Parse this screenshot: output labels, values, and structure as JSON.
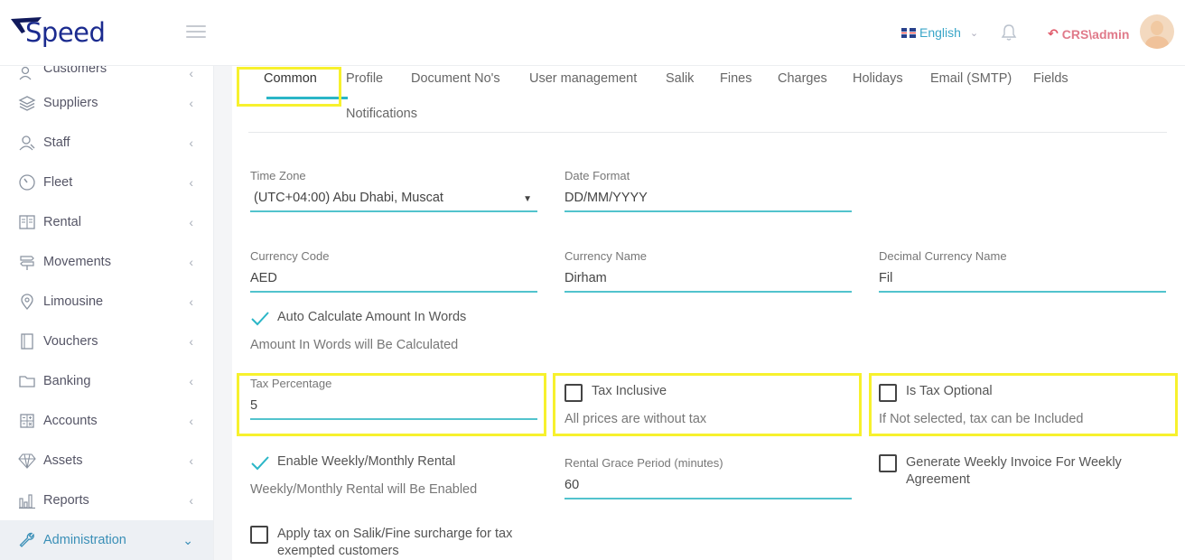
{
  "brand": {
    "name": "Speed"
  },
  "header": {
    "language": "English",
    "user": "CRS\\admin"
  },
  "sidebar": {
    "items": [
      {
        "label": "Customers",
        "icon": "users-icon"
      },
      {
        "label": "Suppliers",
        "icon": "layers-icon"
      },
      {
        "label": "Staff",
        "icon": "staff-icon"
      },
      {
        "label": "Fleet",
        "icon": "gauge-icon"
      },
      {
        "label": "Rental",
        "icon": "book-icon"
      },
      {
        "label": "Movements",
        "icon": "signpost-icon"
      },
      {
        "label": "Limousine",
        "icon": "location-pin-icon"
      },
      {
        "label": "Vouchers",
        "icon": "notebook-icon"
      },
      {
        "label": "Banking",
        "icon": "folder-icon"
      },
      {
        "label": "Accounts",
        "icon": "calculator-icon"
      },
      {
        "label": "Assets",
        "icon": "diamond-icon"
      },
      {
        "label": "Reports",
        "icon": "bar-chart-icon"
      },
      {
        "label": "Administration",
        "icon": "wrench-icon"
      }
    ]
  },
  "tabs": [
    "Common",
    "Profile",
    "Document No's",
    "User management",
    "Salik",
    "Fines",
    "Charges",
    "Holidays",
    "Email (SMTP)",
    "Fields",
    "Notifications"
  ],
  "form": {
    "time_zone": {
      "label": "Time Zone",
      "value": "(UTC+04:00) Abu Dhabi, Muscat"
    },
    "date_format": {
      "label": "Date Format",
      "value": "DD/MM/YYYY"
    },
    "currency_code": {
      "label": "Currency Code",
      "value": "AED"
    },
    "currency_name": {
      "label": "Currency Name",
      "value": "Dirham"
    },
    "decimal_currency_name": {
      "label": "Decimal Currency Name",
      "value": "Fil"
    },
    "auto_calc": {
      "label": "Auto Calculate Amount In Words",
      "hint": "Amount In Words will Be Calculated",
      "checked": true
    },
    "tax_percentage": {
      "label": "Tax Percentage",
      "value": "5"
    },
    "tax_inclusive": {
      "label": "Tax Inclusive",
      "hint": "All prices are without tax",
      "checked": false
    },
    "tax_optional": {
      "label": "Is Tax Optional",
      "hint": "If Not selected, tax can be Included",
      "checked": false
    },
    "weekly_rental": {
      "label": "Enable Weekly/Monthly Rental",
      "hint": "Weekly/Monthly Rental will Be Enabled",
      "checked": true
    },
    "grace_period": {
      "label": "Rental Grace Period (minutes)",
      "value": "60"
    },
    "weekly_invoice": {
      "label_line1": "Generate Weekly Invoice For Weekly",
      "label_line2": "Agreement",
      "checked": false
    },
    "salik_tax": {
      "label_line1": "Apply tax on Salik/Fine surcharge for tax",
      "label_line2": "exempted customers",
      "checked": false
    }
  },
  "colors": {
    "accent": "#52c3cd",
    "highlight": "#f7f12d",
    "brand": "#1b2b8f"
  }
}
